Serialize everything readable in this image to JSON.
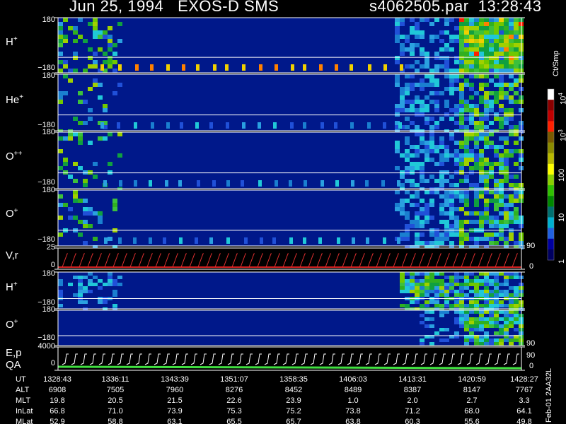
{
  "header": {
    "date": "Jun 25, 1994",
    "mission": "EXOS-D SMS",
    "file": "s4062505.par",
    "time": "13:28:43"
  },
  "panels": [
    {
      "id": "h_plus",
      "species": "H",
      "charge": "+",
      "top_tick": "180",
      "bottom_tick": "−180"
    },
    {
      "id": "he_plus",
      "species": "He",
      "charge": "+",
      "top_tick": "180",
      "bottom_tick": "−180"
    },
    {
      "id": "o_pp",
      "species": "O",
      "charge": "++",
      "top_tick": "180",
      "bottom_tick": "−180"
    },
    {
      "id": "o_plus",
      "species": "O",
      "charge": "+",
      "top_tick": "180",
      "bottom_tick": "−180"
    },
    {
      "id": "vr",
      "label": "V,r",
      "top_tick": "25",
      "bottom_tick": "0",
      "right_top": "90",
      "right_bottom": "0"
    },
    {
      "id": "h_plus2",
      "species": "H",
      "charge": "+",
      "top_tick": "180",
      "bottom_tick": "−180"
    },
    {
      "id": "o_plus2",
      "species": "O",
      "charge": "+",
      "top_tick": "180",
      "bottom_tick": "−180",
      "right_top": "90"
    },
    {
      "id": "ep",
      "label": "E,p",
      "label2": "QA",
      "top_tick": "4000",
      "bottom_tick": "0",
      "right_top": "90",
      "right_bottom": "0"
    }
  ],
  "colorbar": {
    "unit": "Ct/Smp",
    "ticks": [
      "10",
      "4",
      "10",
      "3",
      "100",
      "10",
      "1"
    ],
    "colors": [
      "#ffffff",
      "#8b0000",
      "#c00000",
      "#ff2000",
      "#7a5a00",
      "#8b8b00",
      "#b8b800",
      "#ffff00",
      "#8bd000",
      "#30c000",
      "#008800",
      "#007070",
      "#00b0d0",
      "#2060e0",
      "#0000a0",
      "#000060"
    ]
  },
  "ephemeris": {
    "rows": [
      "UT",
      "ALT",
      "MLT",
      "InLat",
      "MLat"
    ],
    "columns": [
      [
        "1328:43",
        "6908",
        "19.8",
        "66.8",
        "52.9"
      ],
      [
        "1336:11",
        "7505",
        "20.5",
        "71.0",
        "58.8"
      ],
      [
        "1343:39",
        "7960",
        "21.5",
        "73.9",
        "63.1"
      ],
      [
        "1351:07",
        "8276",
        "22.6",
        "75.3",
        "65.5"
      ],
      [
        "1358:35",
        "8452",
        "23.9",
        "75.2",
        "65.7"
      ],
      [
        "1406:03",
        "8489",
        "1.0",
        "73.8",
        "63.8"
      ],
      [
        "1413:31",
        "8387",
        "2.0",
        "71.2",
        "60.3"
      ],
      [
        "1420:59",
        "8147",
        "2.7",
        "68.0",
        "55.6"
      ],
      [
        "1428:27",
        "7767",
        "3.3",
        "64.1",
        "49.8"
      ]
    ]
  },
  "footer_code": "Feb-01 2AA32L",
  "chart_data": {
    "type": "heatmap",
    "title": "Jun 25, 1994   EXOS-D SMS",
    "x_ticks": [
      "1328:43",
      "1336:11",
      "1343:39",
      "1351:07",
      "1358:35",
      "1406:03",
      "1413:31",
      "1420:59",
      "1428:27"
    ],
    "series": [
      {
        "name": "H+",
        "ylim": [
          -180,
          180
        ]
      },
      {
        "name": "He+",
        "ylim": [
          -180,
          180
        ]
      },
      {
        "name": "O++",
        "ylim": [
          -180,
          180
        ]
      },
      {
        "name": "O+",
        "ylim": [
          -180,
          180
        ]
      },
      {
        "name": "V,r",
        "ylim": [
          0,
          25
        ]
      },
      {
        "name": "H+",
        "ylim": [
          -180,
          180
        ]
      },
      {
        "name": "O+",
        "ylim": [
          -180,
          180
        ]
      },
      {
        "name": "E,p",
        "ylim": [
          0,
          4000
        ]
      }
    ],
    "colorbar_scale": "log",
    "colorbar_range": [
      1,
      10000
    ],
    "colorbar_unit": "Ct/Smp"
  }
}
